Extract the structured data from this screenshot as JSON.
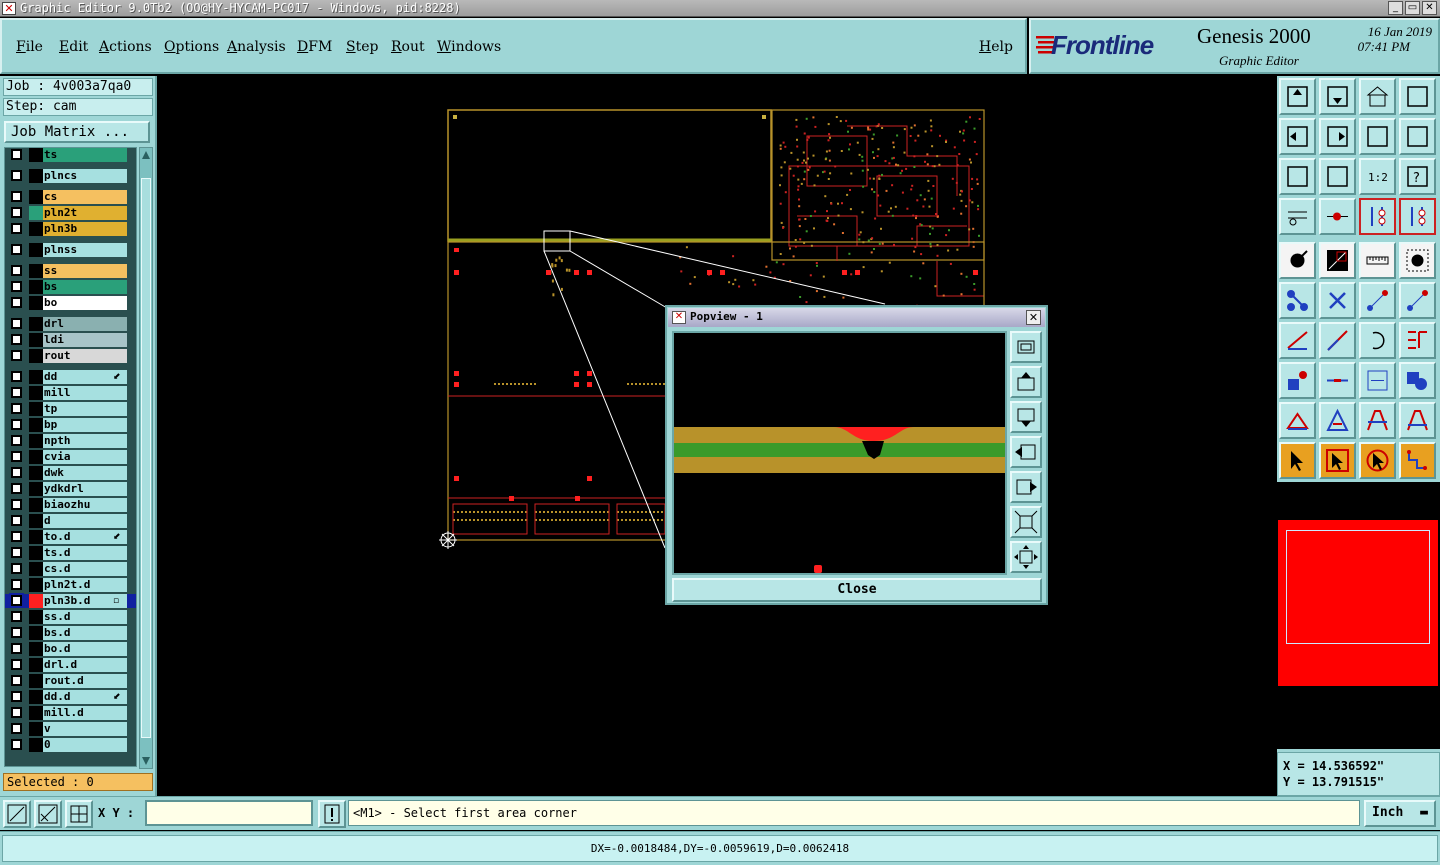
{
  "window": {
    "title": "Graphic Editor 9.0Tb2 (OO@HY-HYCAM-PC017 - Windows, pid:8228)",
    "buttons": [
      "_",
      "▭",
      "✕"
    ]
  },
  "menu": [
    "File",
    "Edit",
    "Actions",
    "Options",
    "Analysis",
    "DFM",
    "Step",
    "Rout",
    "Windows",
    "Help"
  ],
  "brand": {
    "logo": "Frontline",
    "product": "Genesis 2000",
    "subtitle": "Graphic Editor",
    "date": "16 Jan 2019",
    "time": "07:41 PM"
  },
  "job": {
    "job_line": "Job : 4v003a7qa0",
    "step_line": "Step: cam",
    "matrix_button": "Job Matrix ..."
  },
  "layers": [
    {
      "name": "ts",
      "color": "#2aa07a"
    },
    {
      "name": "plncs",
      "color": "#a6e0e0",
      "gap": true
    },
    {
      "name": "cs",
      "color": "#f5c060",
      "gap": true
    },
    {
      "name": "pln2t",
      "color": "#e0b030",
      "dot": "#2aa07a"
    },
    {
      "name": "pln3b",
      "color": "#e0b030"
    },
    {
      "name": "plnss",
      "color": "#a6e0e0",
      "gap": true
    },
    {
      "name": "ss",
      "color": "#f5c060",
      "gap": true
    },
    {
      "name": "bs",
      "color": "#2aa07a"
    },
    {
      "name": "bo",
      "color": "#ffffff"
    },
    {
      "name": "drl",
      "color": "#8ab0b0",
      "gap": true
    },
    {
      "name": "ldi",
      "color": "#a8c4c8"
    },
    {
      "name": "rout",
      "color": "#d8d8d8"
    },
    {
      "name": "dd",
      "color": "#a6e0e0",
      "gap": true,
      "mark": "⬋"
    },
    {
      "name": "mill",
      "color": "#a6e0e0"
    },
    {
      "name": "tp",
      "color": "#a6e0e0"
    },
    {
      "name": "bp",
      "color": "#a6e0e0"
    },
    {
      "name": "npth",
      "color": "#a6e0e0"
    },
    {
      "name": "cvia",
      "color": "#a6e0e0"
    },
    {
      "name": "dwk",
      "color": "#a6e0e0"
    },
    {
      "name": "ydkdrl",
      "color": "#a6e0e0"
    },
    {
      "name": "biaozhu",
      "color": "#a6e0e0"
    },
    {
      "name": "d",
      "color": "#a6e0e0"
    },
    {
      "name": "to.d",
      "color": "#a6e0e0",
      "mark": "⬋"
    },
    {
      "name": "ts.d",
      "color": "#a6e0e0"
    },
    {
      "name": "cs.d",
      "color": "#a6e0e0"
    },
    {
      "name": "pln2t.d",
      "color": "#a6e0e0"
    },
    {
      "name": "pln3b.d",
      "color": "#a6e0e0",
      "dot": "#ff2020",
      "active": true,
      "mark": "▫"
    },
    {
      "name": "ss.d",
      "color": "#a6e0e0"
    },
    {
      "name": "bs.d",
      "color": "#a6e0e0"
    },
    {
      "name": "bo.d",
      "color": "#a6e0e0"
    },
    {
      "name": "drl.d",
      "color": "#a6e0e0"
    },
    {
      "name": "rout.d",
      "color": "#a6e0e0"
    },
    {
      "name": "dd.d",
      "color": "#a6e0e0",
      "mark": "⬋"
    },
    {
      "name": "mill.d",
      "color": "#a6e0e0"
    },
    {
      "name": "v",
      "color": "#a6e0e0"
    },
    {
      "name": "0",
      "color": "#a6e0e0"
    }
  ],
  "selected": "Selected : 0",
  "popview": {
    "title": "Popview - 1",
    "close_label": "Close"
  },
  "coords": {
    "x": "X = 14.536592\"",
    "y": "Y = 13.791515\""
  },
  "command": {
    "xy_label": "X Y :",
    "xy_value": "",
    "message": "<M1> - Select first area corner",
    "unit": "Inch"
  },
  "status": "DX=-0.0018484,DY=-0.0059619,D=0.0062418",
  "colors": {
    "panel": "#9ed6d6",
    "board_outline": "#b8922a",
    "copper_red": "#ff2020",
    "mini_view": "#ff0000"
  }
}
